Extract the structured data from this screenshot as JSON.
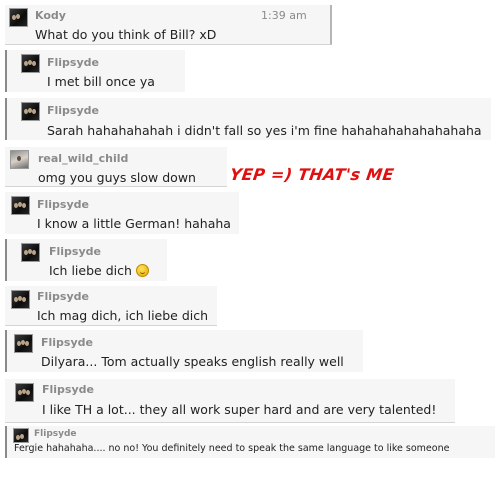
{
  "messages": [
    {
      "name": "Kody",
      "time": "1:39 am",
      "text": "What do you think of Bill? xD"
    },
    {
      "name": "Flipsyde",
      "text": "I met bill once ya"
    },
    {
      "name": "Flipsyde",
      "text": "Sarah hahahahahah i didn't fall so yes i'm fine hahahahahahahahaha"
    },
    {
      "name": "real_wild_child",
      "text": "omg you guys slow down"
    },
    {
      "name": "Flipsyde",
      "text": "I know a little German! hahaha"
    },
    {
      "name": "Flipsyde",
      "text": "Ich liebe dich"
    },
    {
      "name": "Flipsyde",
      "text": "Ich mag dich, ich liebe dich"
    },
    {
      "name": "Flipsyde",
      "text": "Dilyara... Tom actually speaks  english really well"
    },
    {
      "name": "Flipsyde",
      "text": "I like TH a lot... they all work super hard and are very talented!"
    },
    {
      "name": "Flipsyde",
      "text": "Fergie hahahaha.... no no! You definitely need to speak the same language to like someone"
    }
  ],
  "annotation": "YEP =) THAT's ME",
  "icons": {
    "smiley": "smiley-emoticon-icon"
  },
  "colors": {
    "annotation": "#e01010",
    "name": "#8a8a8a",
    "bubble": "#f6f6f6"
  }
}
